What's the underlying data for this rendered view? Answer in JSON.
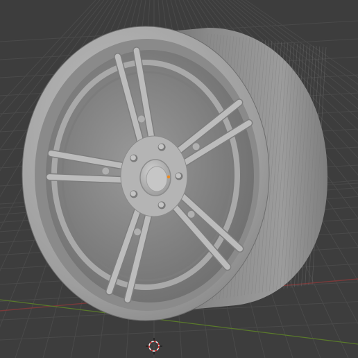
{
  "viewport": {
    "kind": "3d-viewport",
    "background_color": "#3d3d3d",
    "grid_line_color": "#4a4a4a",
    "x_axis_color": "#7a3a3a",
    "y_axis_color": "#5a7a2a"
  },
  "object": {
    "kind": "multi-spoke-wheel-rim",
    "spoke_count": 5,
    "lug_nut_count": 5,
    "shade_color": "#8f8f8f",
    "highlight_color": "#c2c2c2",
    "dark_color": "#5a5a5a"
  },
  "gizmos": {
    "origin_point_color": "#f08a1c",
    "cursor_3d_icon": "3d-cursor-icon"
  }
}
